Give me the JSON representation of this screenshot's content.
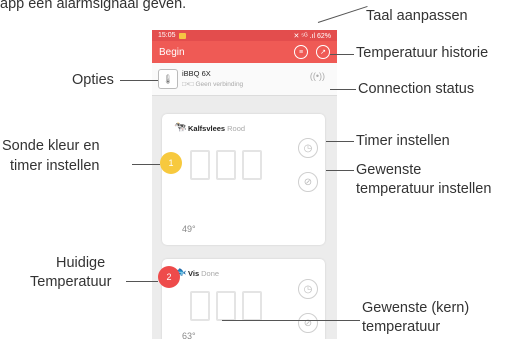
{
  "caption_top": "app een alarmsignaal geven.",
  "status_bar": {
    "time": "15:05",
    "indicators": "✕ ⁵ᴳ .ıl 62%"
  },
  "app_bar": {
    "title": "Begin",
    "icons": [
      "language-icon",
      "history-icon"
    ]
  },
  "device": {
    "name": "iBBQ 6X",
    "status": "Geen verbinding",
    "connection_glyph": "□×□"
  },
  "probes": [
    {
      "number": "1",
      "name": "Kalfsvlees",
      "doneness": "Rood",
      "current_temp": "49°",
      "color": "#f7c93e",
      "animal_icon": "cow-icon"
    },
    {
      "number": "2",
      "name": "Vis",
      "doneness": "Done",
      "current_temp": "63°",
      "color": "#ee4b4b",
      "animal_icon": "fish-icon"
    }
  ],
  "annotations": {
    "taal": "Taal aanpassen",
    "historie": "Temperatuur historie",
    "opties": "Opties",
    "connection": "Connection status",
    "sonde_1": "Sonde kleur en",
    "sonde_2": "timer instellen",
    "timer": "Timer instellen",
    "gewenste_1": "Gewenste",
    "gewenste_2": "temperatuur instellen",
    "huidige_1": "Huidige",
    "huidige_2": "Temperatuur",
    "kern_1": "Gewenste (kern)",
    "kern_2": "temperatuur"
  },
  "colors": {
    "header": "#ef5a55",
    "status_bar": "#e34d4d"
  }
}
